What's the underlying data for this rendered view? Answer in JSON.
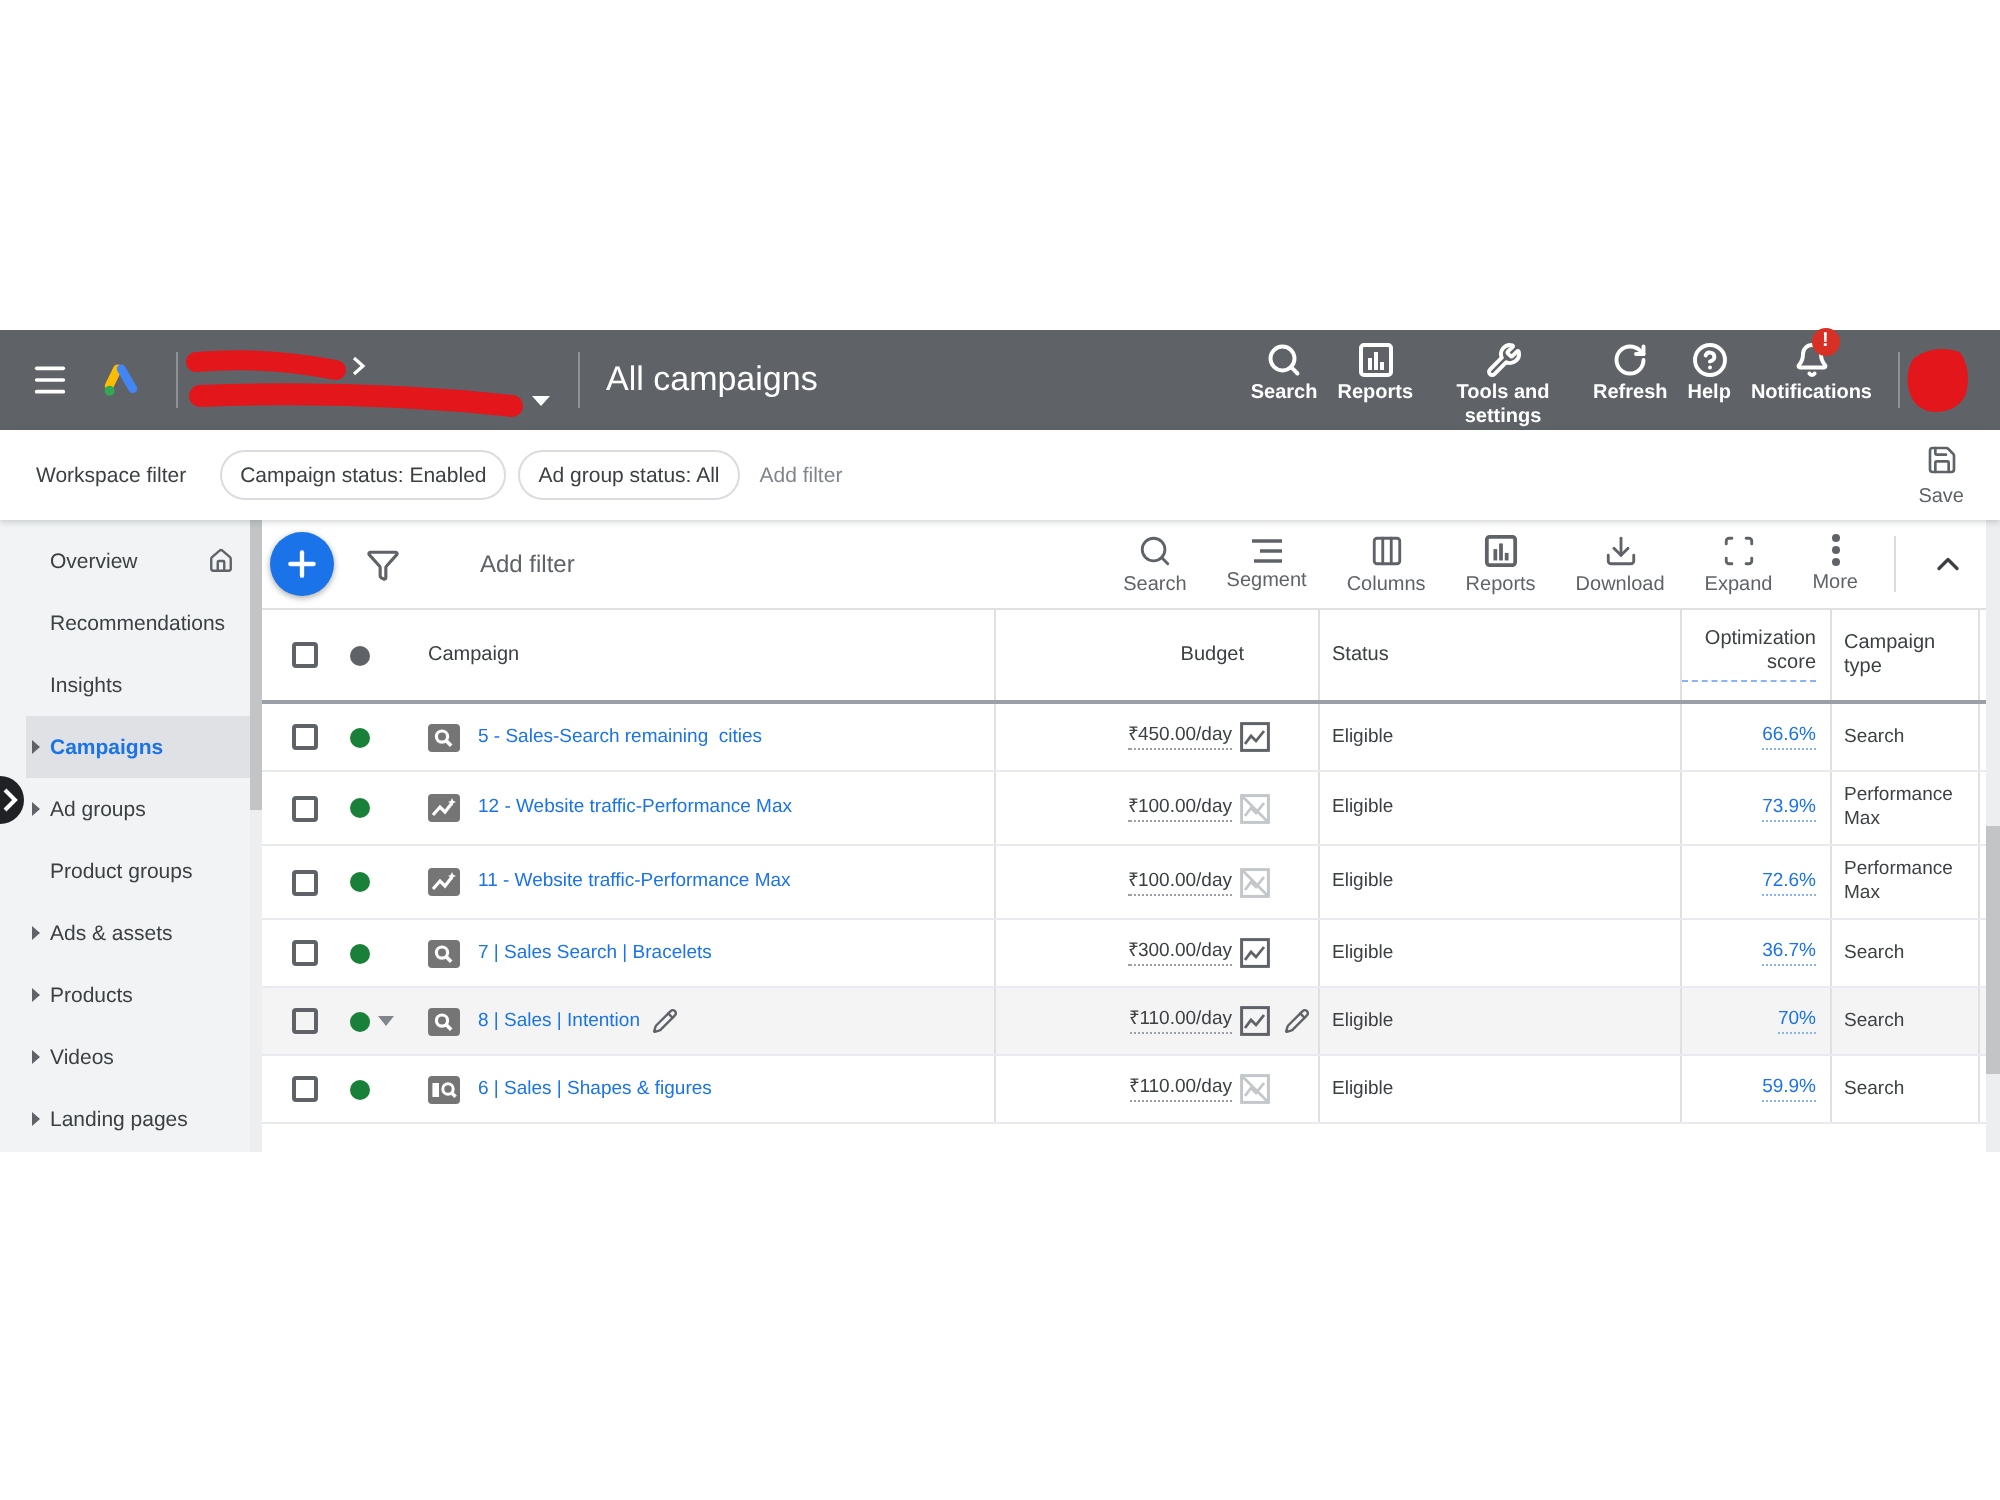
{
  "header": {
    "title": "All campaigns",
    "actions": [
      {
        "kind": "search",
        "label": "Search"
      },
      {
        "kind": "reports",
        "label": "Reports"
      },
      {
        "kind": "tools",
        "label": "Tools and settings"
      },
      {
        "kind": "refresh",
        "label": "Refresh"
      },
      {
        "kind": "help",
        "label": "Help"
      },
      {
        "kind": "notifications",
        "label": "Notifications",
        "badge": "!"
      }
    ]
  },
  "workspace_filter": {
    "label": "Workspace filter",
    "chips": [
      {
        "label": "Campaign status: Enabled"
      },
      {
        "label": "Ad group status: All"
      }
    ],
    "add_filter": "Add filter",
    "save": "Save"
  },
  "sidebar": {
    "items": [
      {
        "label": "Overview",
        "kind": "home",
        "expandable": false,
        "selected": false
      },
      {
        "label": "Recommendations",
        "kind": "page",
        "expandable": false,
        "selected": false
      },
      {
        "label": "Insights",
        "kind": "page",
        "expandable": false,
        "selected": false
      },
      {
        "label": "Campaigns",
        "kind": "page",
        "expandable": true,
        "selected": true
      },
      {
        "label": "Ad groups",
        "kind": "page",
        "expandable": true,
        "selected": false
      },
      {
        "label": "Product groups",
        "kind": "page",
        "expandable": false,
        "selected": false
      },
      {
        "label": "Ads & assets",
        "kind": "page",
        "expandable": true,
        "selected": false
      },
      {
        "label": "Products",
        "kind": "page",
        "expandable": true,
        "selected": false
      },
      {
        "label": "Videos",
        "kind": "page",
        "expandable": true,
        "selected": false
      },
      {
        "label": "Landing pages",
        "kind": "page",
        "expandable": true,
        "selected": false
      }
    ]
  },
  "toolbar": {
    "filter_field": {
      "placeholder": "Add filter"
    },
    "tools": [
      {
        "kind": "search",
        "label": "Search"
      },
      {
        "kind": "segment",
        "label": "Segment"
      },
      {
        "kind": "columns",
        "label": "Columns"
      },
      {
        "kind": "reports",
        "label": "Reports"
      },
      {
        "kind": "download",
        "label": "Download"
      },
      {
        "kind": "expand",
        "label": "Expand"
      },
      {
        "kind": "more",
        "label": "More"
      }
    ]
  },
  "table": {
    "select_all_checked": false,
    "columns": [
      {
        "label": "Campaign"
      },
      {
        "label": "Budget"
      },
      {
        "label": "Status"
      },
      {
        "label": "Optimization score"
      },
      {
        "label": "Campaign type"
      }
    ],
    "rows": [
      {
        "checked": false,
        "enabled": true,
        "kind": "search",
        "hovered": false,
        "name": "5 - Sales-Search remaining  cities",
        "budget": "₹450.00/day",
        "budget_chart_enabled": true,
        "status": "Eligible",
        "optimization_score": "66.6%",
        "campaign_type": "Search"
      },
      {
        "checked": false,
        "enabled": true,
        "kind": "pmax",
        "hovered": false,
        "name": "12 - Website traffic-Performance Max",
        "budget": "₹100.00/day",
        "budget_chart_enabled": false,
        "status": "Eligible",
        "optimization_score": "73.9%",
        "campaign_type": "Performance Max"
      },
      {
        "checked": false,
        "enabled": true,
        "kind": "pmax",
        "hovered": false,
        "name": "11 - Website traffic-Performance Max",
        "budget": "₹100.00/day",
        "budget_chart_enabled": false,
        "status": "Eligible",
        "optimization_score": "72.6%",
        "campaign_type": "Performance Max"
      },
      {
        "checked": false,
        "enabled": true,
        "kind": "search",
        "hovered": false,
        "name": "7 | Sales Search | Bracelets",
        "budget": "₹300.00/day",
        "budget_chart_enabled": true,
        "status": "Eligible",
        "optimization_score": "36.7%",
        "campaign_type": "Search"
      },
      {
        "checked": false,
        "enabled": true,
        "kind": "search",
        "hovered": true,
        "name": "8 | Sales | Intention",
        "budget": "₹110.00/day",
        "budget_chart_enabled": true,
        "status": "Eligible",
        "optimization_score": "70%",
        "campaign_type": "Search"
      },
      {
        "checked": false,
        "enabled": true,
        "kind": "catalog",
        "hovered": false,
        "name": "6 | Sales | Shapes & figures",
        "budget": "₹110.00/day",
        "budget_chart_enabled": false,
        "status": "Eligible",
        "optimization_score": "59.9%",
        "campaign_type": "Search"
      }
    ]
  }
}
